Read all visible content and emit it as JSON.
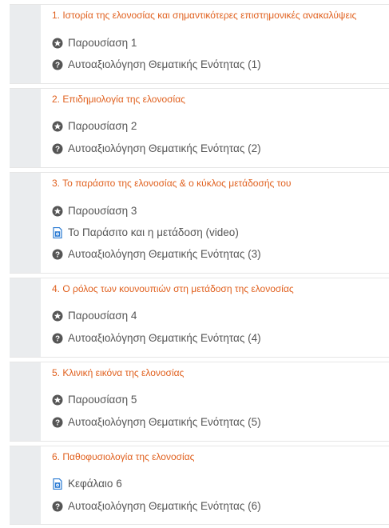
{
  "sections": [
    {
      "title": "1. Ιστορία της ελονοσίας και σημαντικότερες επιστημονικές ανακαλύψεις",
      "activities": [
        {
          "icon": "presentation-icon",
          "label": "Παρουσίαση 1"
        },
        {
          "icon": "quiz-icon",
          "label": "Αυτοαξιολόγηση Θεματικής Ενότητας (1)"
        }
      ]
    },
    {
      "title": "2. Επιδημιολογία της ελονοσίας",
      "activities": [
        {
          "icon": "presentation-icon",
          "label": "Παρουσίαση 2"
        },
        {
          "icon": "quiz-icon",
          "label": "Αυτοαξιολόγηση Θεματικής Ενότητας (2)"
        }
      ]
    },
    {
      "title": "3. Το παράσιτο της ελονοσίας & ο κύκλος μετάδοσής του",
      "activities": [
        {
          "icon": "presentation-icon",
          "label": "Παρουσίαση 3"
        },
        {
          "icon": "document-icon",
          "label": "Το Παράσιτο και η μετάδοση (video)"
        },
        {
          "icon": "quiz-icon",
          "label": "Αυτοαξιολόγηση Θεματικής Ενότητας (3)"
        }
      ]
    },
    {
      "title": "4. Ο ρόλος των κουνουπιών στη μετάδοση της ελονοσίας",
      "activities": [
        {
          "icon": "presentation-icon",
          "label": "Παρουσίαση 4"
        },
        {
          "icon": "quiz-icon",
          "label": "Αυτοαξιολόγηση Θεματικής Ενότητας (4)"
        }
      ]
    },
    {
      "title": "5. Κλινική εικόνα της ελονοσίας",
      "activities": [
        {
          "icon": "presentation-icon",
          "label": "Παρουσίαση 5"
        },
        {
          "icon": "quiz-icon",
          "label": "Αυτοαξιολόγηση Θεματικής Ενότητας (5)"
        }
      ]
    },
    {
      "title": "6. Παθοφυσιολογία της ελονοσίας",
      "activities": [
        {
          "icon": "document-icon",
          "label": "Κεφάλαιο 6"
        },
        {
          "icon": "quiz-icon",
          "label": "Αυτοαξιολόγηση Θεματικής Ενότητας (6)"
        }
      ]
    }
  ],
  "colors": {
    "title": "#e0601e",
    "text": "#555555",
    "stripe": "#eaecee",
    "icon_dark": "#555555",
    "icon_doc": "#2b7bd3"
  }
}
